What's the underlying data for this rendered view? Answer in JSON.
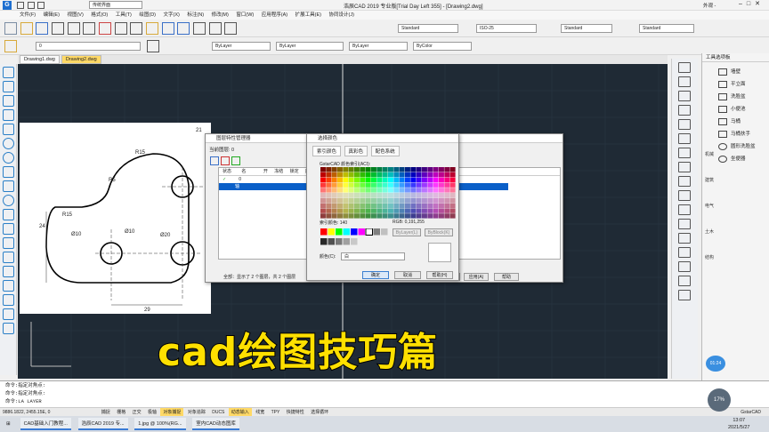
{
  "app": {
    "title": "浩辰CAD 2019 专业版[Trial Day Left 355] - [Drawing2.dwg]",
    "user_label": "外观 -",
    "menu": [
      "文件(F)",
      "编辑(E)",
      "视图(V)",
      "格式(O)",
      "工具(T)",
      "绘图(D)",
      "文字(X)",
      "标注(N)",
      "修改(M)",
      "窗口(W)",
      "应用程序(A)",
      "扩展工具(E)",
      "协同设计(J)"
    ],
    "workspace": "传统界面"
  },
  "toolbar": {
    "text_style": "Standard",
    "dim_style": "ISO-25",
    "table_style": "Standard",
    "mleader_style": "Standard",
    "layer_combo": "0",
    "color_combo": "ByLayer",
    "linetype_combo": "ByLayer",
    "lineweight_combo": "ByLayer",
    "plotstyle_combo": "ByColor"
  },
  "doc_tabs": [
    {
      "label": "Drawing1.dwg",
      "active": false
    },
    {
      "label": "Drawing2.dwg",
      "active": true
    }
  ],
  "drawing": {
    "dims": [
      "21",
      "R15",
      "R5",
      "Ø10",
      "Ø20",
      "R15",
      "24",
      "Ø10",
      "29"
    ]
  },
  "layer_manager": {
    "title": "图层特性管理器",
    "current_layer_label": "当前图层: 0",
    "columns": [
      "状态",
      "名",
      "开",
      "冻结",
      "锁定",
      "颜色",
      "线"
    ],
    "rows": [
      {
        "status": "✓",
        "name": "0"
      },
      {
        "status": "",
        "name": "轴"
      }
    ],
    "footer": "全部：显示了 2 个图层，共 2 个图层",
    "buttons": [
      "确定",
      "取消",
      "应用(A)",
      "帮助"
    ]
  },
  "color_dialog": {
    "title": "选择颜色",
    "tabs": [
      "索引颜色",
      "真彩色",
      "配色系统"
    ],
    "index_label": "GstarCAD 颜色索引(ACI):",
    "index_value": "索引颜色: 140",
    "rgb_value": "RGB: 0,191,255",
    "bylayer_btn": "ByLayer(L)",
    "byblock_btn": "ByBlock(K)",
    "color_label": "颜色(C):",
    "color_value": "白",
    "buttons": [
      "确定",
      "取消",
      "帮助(H)"
    ],
    "colors": {
      "accent": "#1e6fd0",
      "selected_row": "#0a5fc8"
    }
  },
  "palette": {
    "title": "工具选项板",
    "items": [
      "墙壁",
      "平立面",
      "洗脸盆",
      "小便池",
      "马桶",
      "马桶扶手",
      "圆形洗脸盆",
      "坐便器"
    ],
    "side_tabs": [
      "机械",
      "建筑",
      "电气",
      "土木",
      "结构"
    ],
    "badge": "01:24"
  },
  "command": {
    "lines": [
      "命令:指定对角点:",
      "命令:指定对角点:",
      "命令:LA  LAYER"
    ]
  },
  "status": {
    "coords": "9886.1822, 2455.15E, 0",
    "items": [
      "捕捉",
      "栅格",
      "正交",
      "极轴",
      "对象捕捉",
      "对象追踪",
      "DUCS",
      "动态输入",
      "线宽",
      "TPY",
      "快捷特性",
      "选择循环"
    ],
    "brand": "GstarCAD",
    "zoom_badge": "17%"
  },
  "taskbar": {
    "apps": [
      "CAD基础入门教程...",
      "浩辰CAD 2019 专...",
      "1.jpg @ 100%(RG...",
      "室内CAD动态图库"
    ],
    "time": "13:07",
    "date": "2021/5/27"
  },
  "caption": "cad绘图技巧篇"
}
